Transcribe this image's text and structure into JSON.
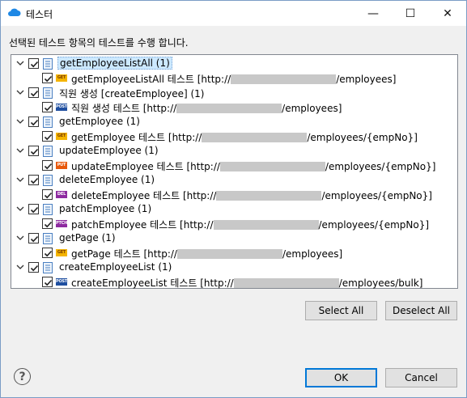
{
  "window": {
    "title": "테스터",
    "controls": {
      "minimize": "—",
      "maximize": "☐",
      "close": "✕"
    }
  },
  "instruction": "선택된 테스트 항목의 테스트를 수행 합니다.",
  "groups": [
    {
      "label": "getEmployeeListAll (1)",
      "selected": true,
      "child": {
        "method": "GET",
        "pre": "getEmployeeListAll 테스트 [http://",
        "post": "/employees]"
      }
    },
    {
      "label": "직원 생성 [createEmployee] (1)",
      "selected": false,
      "child": {
        "method": "POST",
        "pre": "직원 생성 테스트 [http://",
        "post": "/employees]"
      }
    },
    {
      "label": "getEmployee (1)",
      "selected": false,
      "child": {
        "method": "GET",
        "pre": "getEmployee 테스트 [http://",
        "post": "/employees/{empNo}]"
      }
    },
    {
      "label": "updateEmployee (1)",
      "selected": false,
      "child": {
        "method": "PUT",
        "pre": "updateEmployee 테스트 [http://",
        "post": "/employees/{empNo}]"
      }
    },
    {
      "label": "deleteEmployee (1)",
      "selected": false,
      "child": {
        "method": "DEL",
        "pre": "deleteEmployee 테스트 [http://",
        "post": "/employees/{empNo}]"
      }
    },
    {
      "label": "patchEmployee (1)",
      "selected": false,
      "child": {
        "method": "PTCH",
        "pre": "patchEmployee 테스트 [http://",
        "post": "/employees/{empNo}]"
      }
    },
    {
      "label": "getPage (1)",
      "selected": false,
      "child": {
        "method": "GET",
        "pre": "getPage 테스트 [http://",
        "post": "/employees]"
      }
    },
    {
      "label": "createEmployeeList (1)",
      "selected": false,
      "child": {
        "method": "POST",
        "pre": "createEmployeeList 테스트 [http://",
        "post": "/employees/bulk]"
      }
    }
  ],
  "buttons": {
    "select_all": "Select All",
    "deselect_all": "Deselect All",
    "ok": "OK",
    "cancel": "Cancel",
    "help": "?"
  }
}
